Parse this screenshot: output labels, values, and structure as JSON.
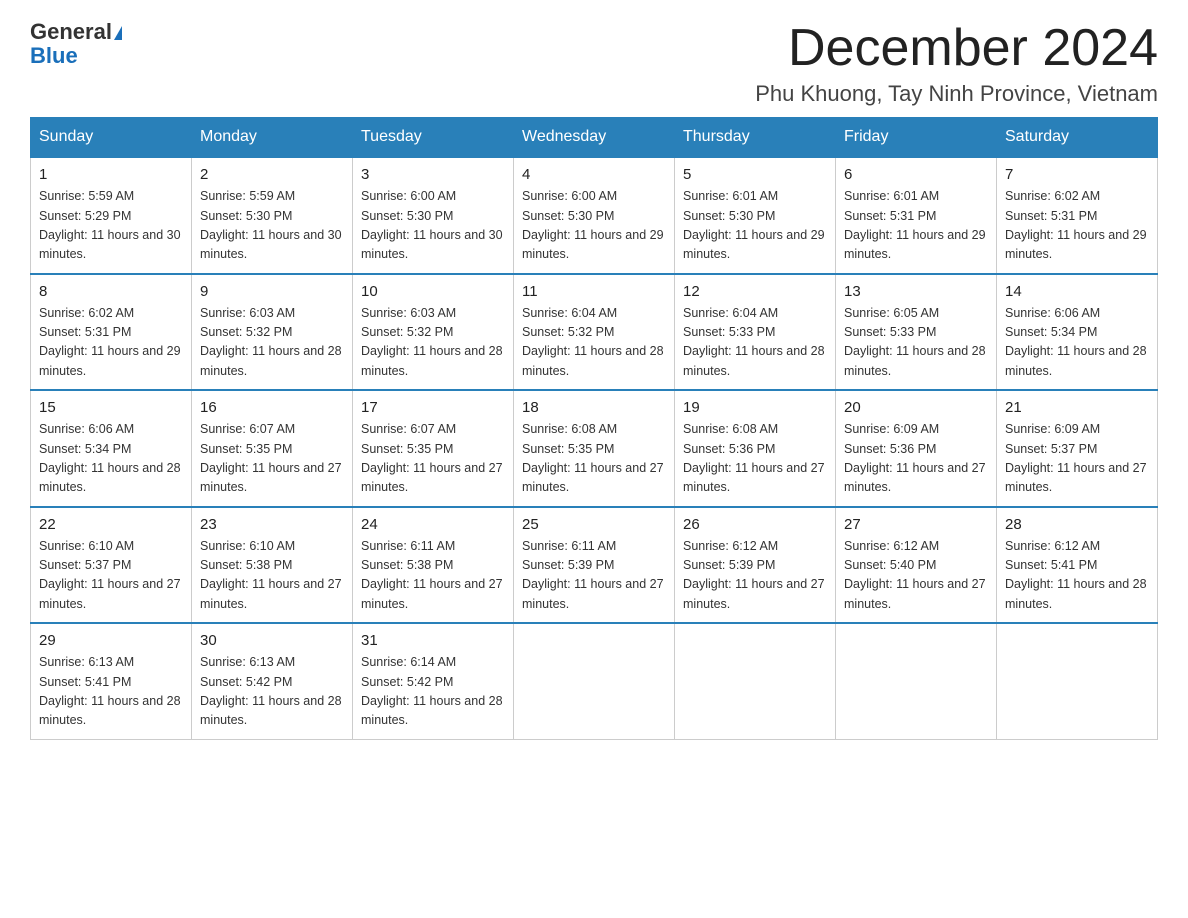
{
  "header": {
    "logo_general": "General",
    "logo_triangle": "▶",
    "logo_blue": "Blue",
    "title": "December 2024",
    "subtitle": "Phu Khuong, Tay Ninh Province, Vietnam"
  },
  "weekdays": [
    "Sunday",
    "Monday",
    "Tuesday",
    "Wednesday",
    "Thursday",
    "Friday",
    "Saturday"
  ],
  "weeks": [
    [
      {
        "day": "1",
        "sunrise": "5:59 AM",
        "sunset": "5:29 PM",
        "daylight": "11 hours and 30 minutes."
      },
      {
        "day": "2",
        "sunrise": "5:59 AM",
        "sunset": "5:30 PM",
        "daylight": "11 hours and 30 minutes."
      },
      {
        "day": "3",
        "sunrise": "6:00 AM",
        "sunset": "5:30 PM",
        "daylight": "11 hours and 30 minutes."
      },
      {
        "day": "4",
        "sunrise": "6:00 AM",
        "sunset": "5:30 PM",
        "daylight": "11 hours and 29 minutes."
      },
      {
        "day": "5",
        "sunrise": "6:01 AM",
        "sunset": "5:30 PM",
        "daylight": "11 hours and 29 minutes."
      },
      {
        "day": "6",
        "sunrise": "6:01 AM",
        "sunset": "5:31 PM",
        "daylight": "11 hours and 29 minutes."
      },
      {
        "day": "7",
        "sunrise": "6:02 AM",
        "sunset": "5:31 PM",
        "daylight": "11 hours and 29 minutes."
      }
    ],
    [
      {
        "day": "8",
        "sunrise": "6:02 AM",
        "sunset": "5:31 PM",
        "daylight": "11 hours and 29 minutes."
      },
      {
        "day": "9",
        "sunrise": "6:03 AM",
        "sunset": "5:32 PM",
        "daylight": "11 hours and 28 minutes."
      },
      {
        "day": "10",
        "sunrise": "6:03 AM",
        "sunset": "5:32 PM",
        "daylight": "11 hours and 28 minutes."
      },
      {
        "day": "11",
        "sunrise": "6:04 AM",
        "sunset": "5:32 PM",
        "daylight": "11 hours and 28 minutes."
      },
      {
        "day": "12",
        "sunrise": "6:04 AM",
        "sunset": "5:33 PM",
        "daylight": "11 hours and 28 minutes."
      },
      {
        "day": "13",
        "sunrise": "6:05 AM",
        "sunset": "5:33 PM",
        "daylight": "11 hours and 28 minutes."
      },
      {
        "day": "14",
        "sunrise": "6:06 AM",
        "sunset": "5:34 PM",
        "daylight": "11 hours and 28 minutes."
      }
    ],
    [
      {
        "day": "15",
        "sunrise": "6:06 AM",
        "sunset": "5:34 PM",
        "daylight": "11 hours and 28 minutes."
      },
      {
        "day": "16",
        "sunrise": "6:07 AM",
        "sunset": "5:35 PM",
        "daylight": "11 hours and 27 minutes."
      },
      {
        "day": "17",
        "sunrise": "6:07 AM",
        "sunset": "5:35 PM",
        "daylight": "11 hours and 27 minutes."
      },
      {
        "day": "18",
        "sunrise": "6:08 AM",
        "sunset": "5:35 PM",
        "daylight": "11 hours and 27 minutes."
      },
      {
        "day": "19",
        "sunrise": "6:08 AM",
        "sunset": "5:36 PM",
        "daylight": "11 hours and 27 minutes."
      },
      {
        "day": "20",
        "sunrise": "6:09 AM",
        "sunset": "5:36 PM",
        "daylight": "11 hours and 27 minutes."
      },
      {
        "day": "21",
        "sunrise": "6:09 AM",
        "sunset": "5:37 PM",
        "daylight": "11 hours and 27 minutes."
      }
    ],
    [
      {
        "day": "22",
        "sunrise": "6:10 AM",
        "sunset": "5:37 PM",
        "daylight": "11 hours and 27 minutes."
      },
      {
        "day": "23",
        "sunrise": "6:10 AM",
        "sunset": "5:38 PM",
        "daylight": "11 hours and 27 minutes."
      },
      {
        "day": "24",
        "sunrise": "6:11 AM",
        "sunset": "5:38 PM",
        "daylight": "11 hours and 27 minutes."
      },
      {
        "day": "25",
        "sunrise": "6:11 AM",
        "sunset": "5:39 PM",
        "daylight": "11 hours and 27 minutes."
      },
      {
        "day": "26",
        "sunrise": "6:12 AM",
        "sunset": "5:39 PM",
        "daylight": "11 hours and 27 minutes."
      },
      {
        "day": "27",
        "sunrise": "6:12 AM",
        "sunset": "5:40 PM",
        "daylight": "11 hours and 27 minutes."
      },
      {
        "day": "28",
        "sunrise": "6:12 AM",
        "sunset": "5:41 PM",
        "daylight": "11 hours and 28 minutes."
      }
    ],
    [
      {
        "day": "29",
        "sunrise": "6:13 AM",
        "sunset": "5:41 PM",
        "daylight": "11 hours and 28 minutes."
      },
      {
        "day": "30",
        "sunrise": "6:13 AM",
        "sunset": "5:42 PM",
        "daylight": "11 hours and 28 minutes."
      },
      {
        "day": "31",
        "sunrise": "6:14 AM",
        "sunset": "5:42 PM",
        "daylight": "11 hours and 28 minutes."
      },
      null,
      null,
      null,
      null
    ]
  ],
  "labels": {
    "sunrise_prefix": "Sunrise: ",
    "sunset_prefix": "Sunset: ",
    "daylight_prefix": "Daylight: "
  }
}
